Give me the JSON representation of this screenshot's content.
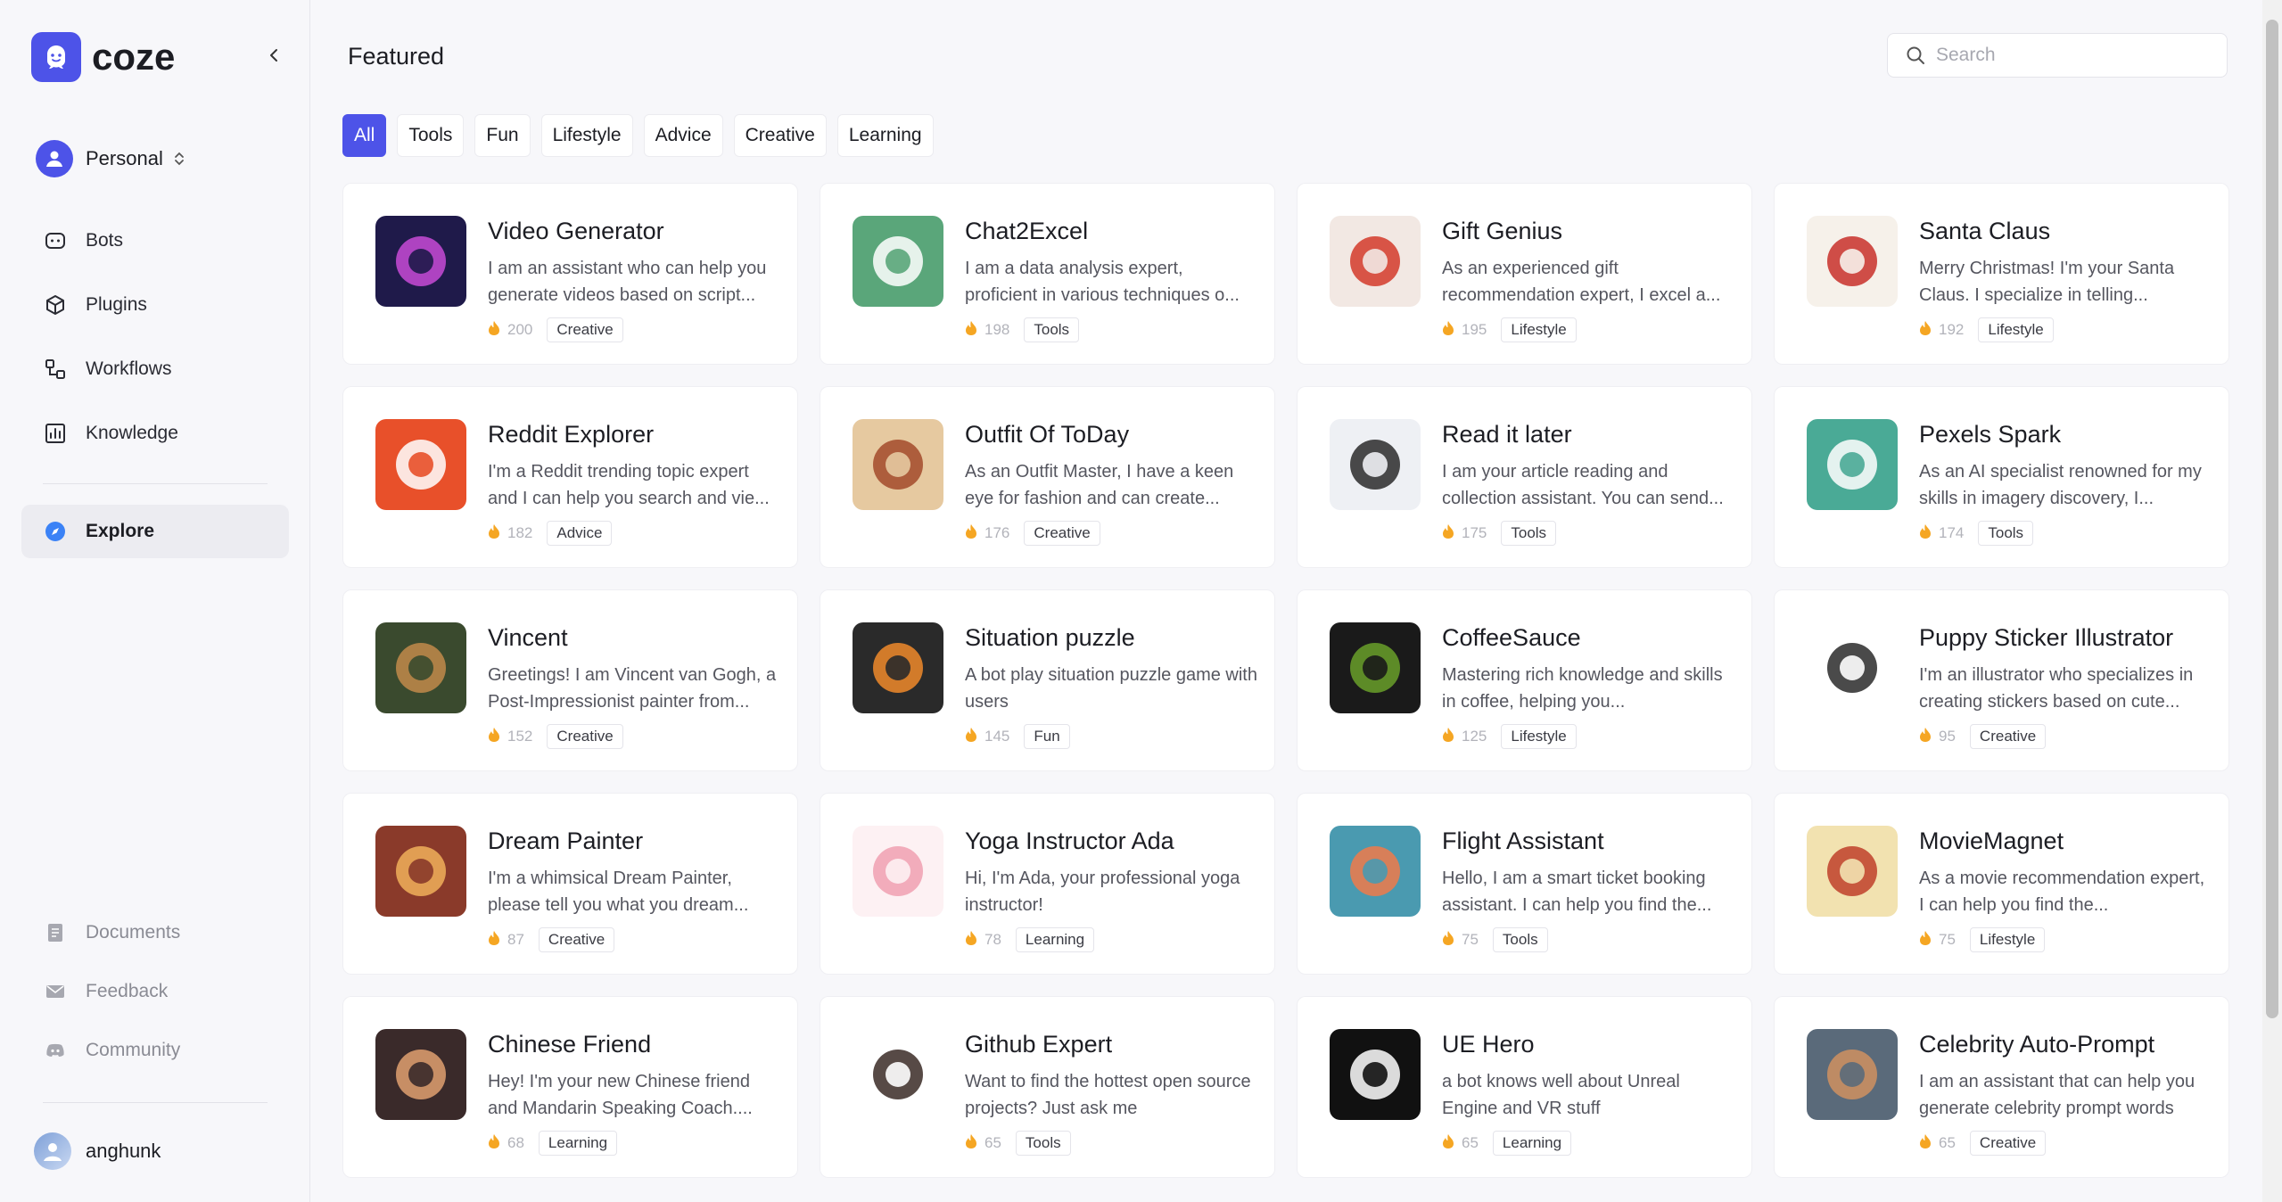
{
  "brand": {
    "name": "coze"
  },
  "workspace": {
    "label": "Personal"
  },
  "nav": [
    {
      "label": "Bots",
      "icon": "bot-icon"
    },
    {
      "label": "Plugins",
      "icon": "cube-icon"
    },
    {
      "label": "Workflows",
      "icon": "workflow-icon"
    },
    {
      "label": "Knowledge",
      "icon": "chart-icon"
    }
  ],
  "explore": {
    "label": "Explore"
  },
  "bottom_nav": [
    {
      "label": "Documents"
    },
    {
      "label": "Feedback"
    },
    {
      "label": "Community"
    }
  ],
  "user": {
    "name": "anghunk"
  },
  "main": {
    "title": "Featured"
  },
  "search": {
    "placeholder": "Search"
  },
  "tabs": [
    "All",
    "Tools",
    "Fun",
    "Lifestyle",
    "Advice",
    "Creative",
    "Learning"
  ],
  "active_tab": "All",
  "colors": {
    "accent": "#4d53e8",
    "fire": "#f5a623"
  },
  "cards": [
    {
      "title": "Video Generator",
      "desc": "I am an assistant who can help you generate videos based on script...",
      "count": "200",
      "tag": "Creative",
      "thumb_bg": "#1f1a4a",
      "thumb_fg": "#c84bd6"
    },
    {
      "title": "Chat2Excel",
      "desc": "I am a data analysis expert, proficient in various techniques o...",
      "count": "198",
      "tag": "Tools",
      "thumb_bg": "#5aa67a",
      "thumb_fg": "#ffffff"
    },
    {
      "title": "Gift Genius",
      "desc": "As an experienced gift recommendation expert, I excel a...",
      "count": "195",
      "tag": "Lifestyle",
      "thumb_bg": "#f2e8e3",
      "thumb_fg": "#d43a2a"
    },
    {
      "title": "Santa Claus",
      "desc": "Merry Christmas! I'm your Santa Claus. I specialize in telling...",
      "count": "192",
      "tag": "Lifestyle",
      "thumb_bg": "#f6f1ea",
      "thumb_fg": "#c8302a"
    },
    {
      "title": "Reddit Explorer",
      "desc": "I'm a Reddit trending topic expert and I can help you search and vie...",
      "count": "182",
      "tag": "Advice",
      "thumb_bg": "#e8502a",
      "thumb_fg": "#ffffff"
    },
    {
      "title": "Outfit Of ToDay",
      "desc": "As an Outfit Master, I have a keen eye for fashion and can create...",
      "count": "176",
      "tag": "Creative",
      "thumb_bg": "#e6c9a0",
      "thumb_fg": "#a24a2a"
    },
    {
      "title": "Read it later",
      "desc": "I am your article reading and collection assistant. You can send...",
      "count": "175",
      "tag": "Tools",
      "thumb_bg": "#eef0f4",
      "thumb_fg": "#2a2a2a"
    },
    {
      "title": "Pexels Spark",
      "desc": "As an AI specialist renowned for my skills in imagery discovery, I...",
      "count": "174",
      "tag": "Tools",
      "thumb_bg": "#4aaa96",
      "thumb_fg": "#ffffff"
    },
    {
      "title": "Vincent",
      "desc": "Greetings! I am Vincent van Gogh, a Post-Impressionist painter from...",
      "count": "152",
      "tag": "Creative",
      "thumb_bg": "#3a4a2e",
      "thumb_fg": "#c28a4a"
    },
    {
      "title": "Situation puzzle",
      "desc": "A bot play situation puzzle game with users",
      "count": "145",
      "tag": "Fun",
      "thumb_bg": "#2a2a2a",
      "thumb_fg": "#f08a2a"
    },
    {
      "title": "CoffeeSauce",
      "desc": "Mastering rich knowledge and skills in coffee, helping you...",
      "count": "125",
      "tag": "Lifestyle",
      "thumb_bg": "#1a1a1a",
      "thumb_fg": "#6aa02a"
    },
    {
      "title": "Puppy Sticker Illustrator",
      "desc": "I'm an illustrator who specializes in creating stickers based on cute...",
      "count": "95",
      "tag": "Creative",
      "thumb_bg": "#ffffff",
      "thumb_fg": "#2a2a2a"
    },
    {
      "title": "Dream Painter",
      "desc": "I'm a whimsical Dream Painter, please tell you what you dream...",
      "count": "87",
      "tag": "Creative",
      "thumb_bg": "#8a3a2a",
      "thumb_fg": "#f0b05a"
    },
    {
      "title": "Yoga Instructor Ada",
      "desc": "Hi, I'm Ada, your professional yoga instructor!",
      "count": "78",
      "tag": "Learning",
      "thumb_bg": "#fdf1f3",
      "thumb_fg": "#f0a0b0"
    },
    {
      "title": "Flight Assistant",
      "desc": "Hello, I am a smart ticket booking assistant. I can help you find the...",
      "count": "75",
      "tag": "Tools",
      "thumb_bg": "#4a9ab0",
      "thumb_fg": "#f07a4a"
    },
    {
      "title": "MovieMagnet",
      "desc": "As a movie recommendation expert, I can help you find the...",
      "count": "75",
      "tag": "Lifestyle",
      "thumb_bg": "#f2e2b0",
      "thumb_fg": "#c0402a"
    },
    {
      "title": "Chinese Friend",
      "desc": "Hey! I'm your new Chinese friend and Mandarin Speaking Coach....",
      "count": "68",
      "tag": "Learning",
      "thumb_bg": "#3a2a2a",
      "thumb_fg": "#e0a070"
    },
    {
      "title": "Github Expert",
      "desc": "Want to find the hottest open source projects? Just ask me",
      "count": "65",
      "tag": "Tools",
      "thumb_bg": "#ffffff",
      "thumb_fg": "#3a2a26"
    },
    {
      "title": "UE Hero",
      "desc": "a bot knows well about Unreal Engine and VR stuff",
      "count": "65",
      "tag": "Learning",
      "thumb_bg": "#111111",
      "thumb_fg": "#ffffff"
    },
    {
      "title": "Celebrity Auto-Prompt",
      "desc": "I am an assistant that can help you generate celebrity prompt words",
      "count": "65",
      "tag": "Creative",
      "thumb_bg": "#5a6a7a",
      "thumb_fg": "#d09060"
    }
  ]
}
